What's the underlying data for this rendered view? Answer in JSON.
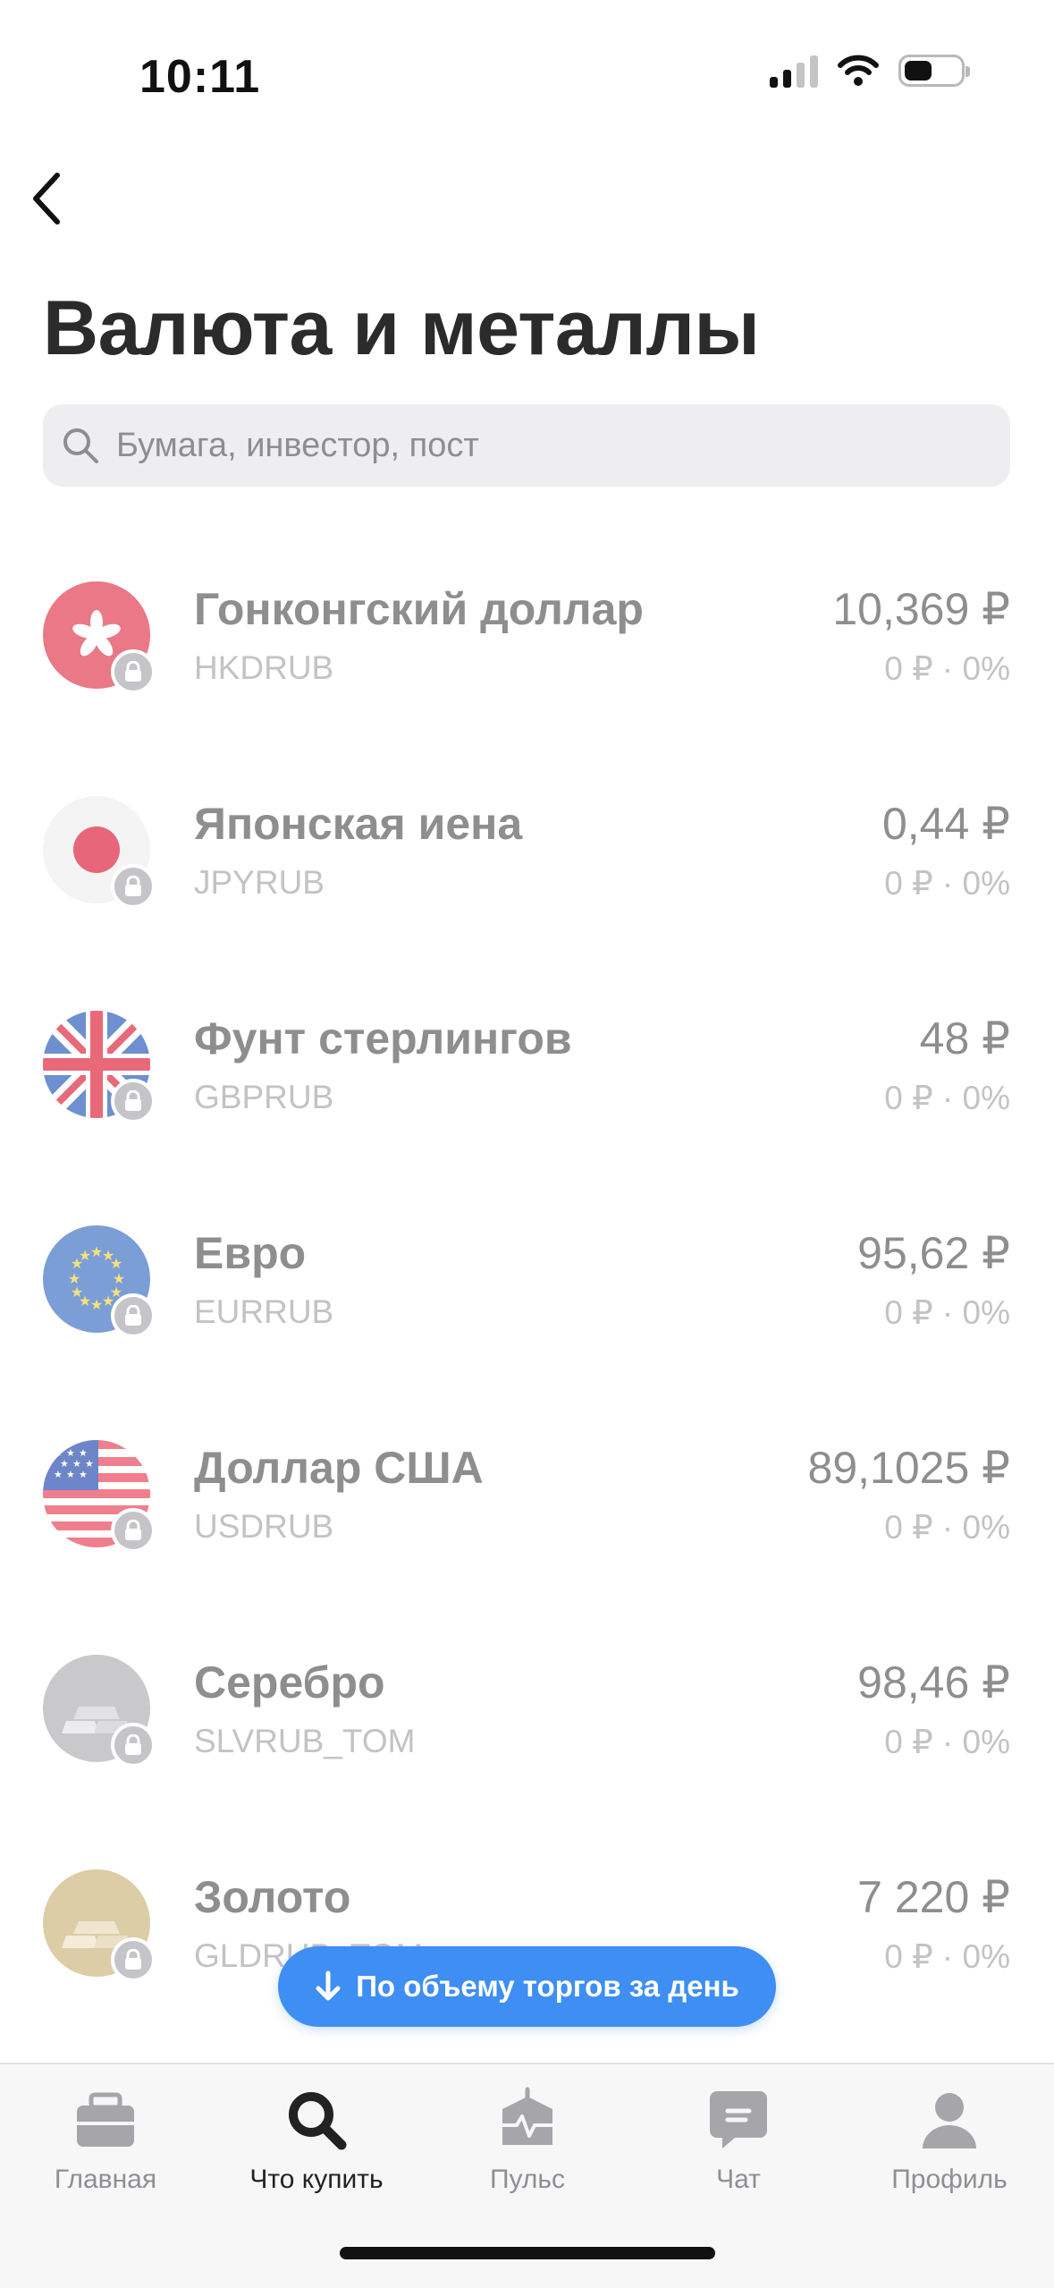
{
  "status_bar": {
    "time": "10:11"
  },
  "header": {
    "title": "Валюта и металлы"
  },
  "search": {
    "placeholder": "Бумага, инвестор, пост"
  },
  "assets": [
    {
      "name": "Гонконгский доллар",
      "ticker": "HKDRUB",
      "price": "10,369 ₽",
      "change": "0 ₽ · 0%",
      "icon": "hong-kong-flag-icon"
    },
    {
      "name": "Японская иена",
      "ticker": "JPYRUB",
      "price": "0,44 ₽",
      "change": "0 ₽ · 0%",
      "icon": "japan-flag-icon"
    },
    {
      "name": "Фунт стерлингов",
      "ticker": "GBPRUB",
      "price": "48 ₽",
      "change": "0 ₽ · 0%",
      "icon": "uk-flag-icon"
    },
    {
      "name": "Евро",
      "ticker": "EURRUB",
      "price": "95,62 ₽",
      "change": "0 ₽ · 0%",
      "icon": "eu-flag-icon"
    },
    {
      "name": "Доллар США",
      "ticker": "USDRUB",
      "price": "89,1025 ₽",
      "change": "0 ₽ · 0%",
      "icon": "us-flag-icon"
    },
    {
      "name": "Серебро",
      "ticker": "SLVRUB_TOM",
      "price": "98,46 ₽",
      "change": "0 ₽ · 0%",
      "icon": "silver-bars-icon"
    },
    {
      "name": "Золото",
      "ticker": "GLDRUB_TOM",
      "price": "7 220 ₽",
      "change": "0 ₽ · 0%",
      "icon": "gold-bars-icon"
    }
  ],
  "sort_button": {
    "label": "По объему торгов за день"
  },
  "tabs": [
    {
      "label": "Главная",
      "icon": "briefcase-icon",
      "active": false
    },
    {
      "label": "Что купить",
      "icon": "search-icon",
      "active": true
    },
    {
      "label": "Пульс",
      "icon": "pulse-icon",
      "active": false
    },
    {
      "label": "Чат",
      "icon": "chat-icon",
      "active": false
    },
    {
      "label": "Профиль",
      "icon": "profile-icon",
      "active": false
    }
  ],
  "colors": {
    "accent": "#3e8ef3",
    "muted_text": "#8e8e8e",
    "light_text": "#c3c3c6"
  }
}
